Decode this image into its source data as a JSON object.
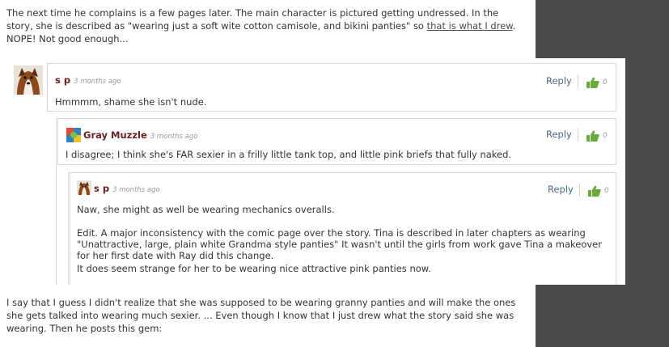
{
  "article": {
    "paragraph1_a": "The next time he complains is a few pages later. The main character is pictured getting undressed. In the story, she is described as \"wearing just a soft wite cotton camisole, and bikini panties\" so ",
    "paragraph1_link": "that is what I drew",
    "paragraph1_b": ". NOPE! Not good enough...",
    "paragraph2": "I say that I guess I didn't realize that she was supposed to be wearing granny panties and will make the ones she gets talked into wearing much sexier. ... Even though I know that I just drew what the story said she was wearing. Then he posts this gem:"
  },
  "comments": [
    {
      "author": "s p",
      "time": "3 months ago",
      "text": "Hmmmm, shame she isn't nude.",
      "reply_label": "Reply",
      "likes": "0"
    },
    {
      "author": "Gray Muzzle",
      "time": "3 months ago",
      "text": "I disagree; I think she's FAR sexier in a frilly little tank top, and little pink briefs that fully naked.",
      "reply_label": "Reply",
      "likes": "0"
    },
    {
      "author": "s p",
      "time": "3 months ago",
      "text1": "Naw, she might as well be wearing mechanics overalls.",
      "text2": "Edit. A major inconsistency with the comic page over the story. Tina is described in later chapters as wearing \"Unattractive, large, plain white Grandma style panties\" It wasn't until the girls from work gave Tina a makeover for her first date with Ray did this change.",
      "text3": "It does seem strange for her to be wearing nice attractive pink panties now.",
      "reply_label": "Reply",
      "likes": "0"
    }
  ],
  "icons": {
    "thumb": "thumbs-up-icon",
    "accent": "#6aaa3a",
    "author_color": "#6b1f1f",
    "gutter_color": "#4a4a4a"
  }
}
